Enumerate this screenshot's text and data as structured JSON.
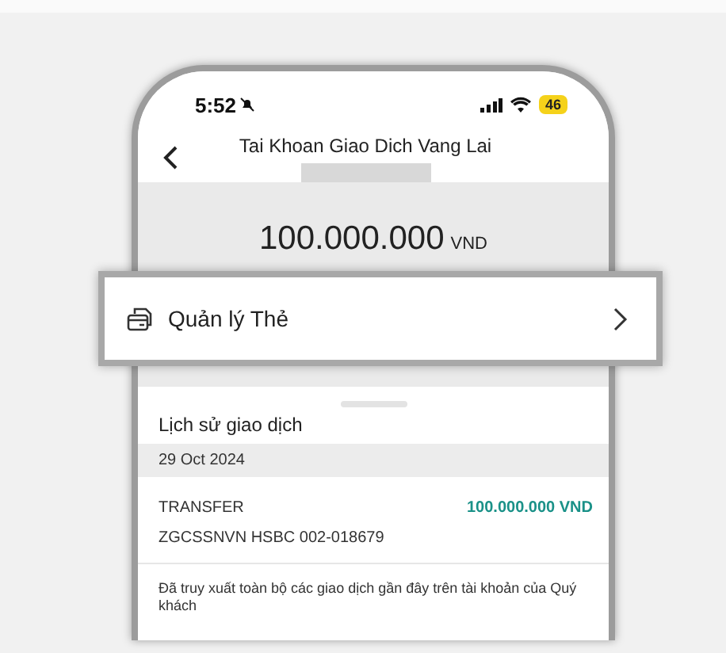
{
  "status_bar": {
    "time": "5:52",
    "battery": "46"
  },
  "header": {
    "title": "Tai Khoan Giao Dich Vang Lai"
  },
  "balance": {
    "amount": "100.000.000",
    "currency": "VND"
  },
  "menu_item": {
    "label": "Quản lý Thẻ"
  },
  "history": {
    "title": "Lịch sử giao dịch",
    "groups": [
      {
        "date": "29 Oct 2024",
        "transactions": [
          {
            "type": "TRANSFER",
            "amount": "100.000.000 VND",
            "reference": "ZGCSSNVN HSBC 002-018679"
          }
        ]
      }
    ],
    "note": "Đã truy xuất toàn bộ các giao dịch gần đây trên tài khoản của Quý khách"
  }
}
